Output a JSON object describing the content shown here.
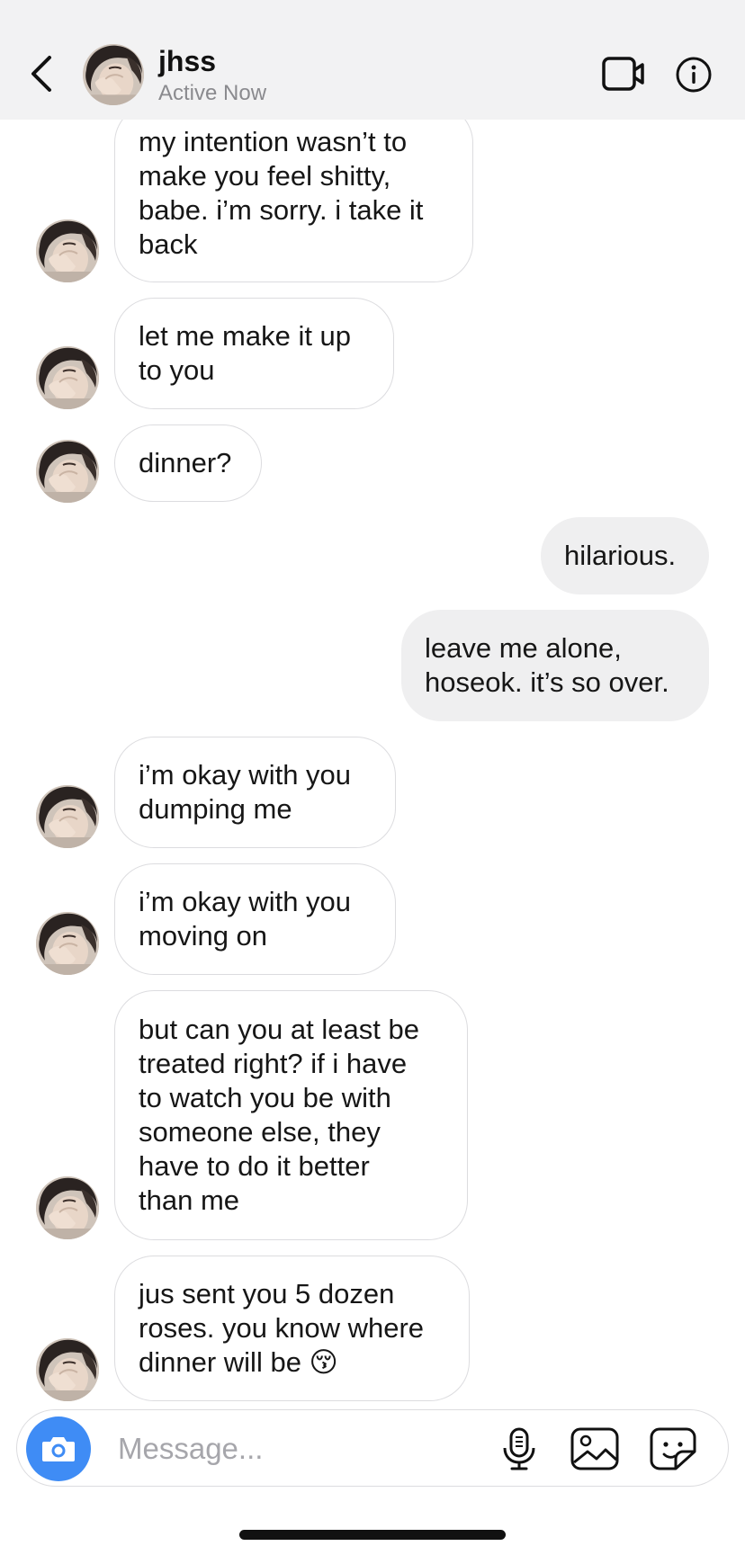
{
  "header": {
    "back_icon": "chevron-left-icon",
    "contact_name": "jhss",
    "status": "Active Now",
    "video_call_icon": "video-camera-icon",
    "info_icon": "info-icon"
  },
  "messages": [
    {
      "sender": "them",
      "text": "my intention wasn’t to\nmake you feel shitty,\nbabe. i’m sorry. i take it\nback"
    },
    {
      "sender": "them",
      "text": "let me make it up\nto you"
    },
    {
      "sender": "them",
      "text": "dinner?"
    },
    {
      "sender": "me",
      "text": "hilarious."
    },
    {
      "sender": "me",
      "text": "leave me alone,\nhoseok. it’s so over."
    },
    {
      "sender": "them",
      "text": "i’m okay with you\ndumping me"
    },
    {
      "sender": "them",
      "text": "i’m okay with you\nmoving on"
    },
    {
      "sender": "them",
      "text": "but can you at least be\ntreated right? if i have\nto watch you be with\nsomeone else, they\nhave to do it better\nthan me"
    },
    {
      "sender": "them",
      "text": "jus sent you 5 dozen\nroses. you know where\ndinner will be 😚"
    }
  ],
  "composer": {
    "placeholder": "Message...",
    "value": "",
    "camera_icon": "camera-icon",
    "mic_icon": "microphone-icon",
    "gallery_icon": "image-icon",
    "sticker_icon": "sticker-icon"
  },
  "colors": {
    "header_bg": "#f2f2f3",
    "outgoing_bubble": "#efeff0",
    "incoming_border": "#dcdcdf",
    "camera_button": "#3f8cf5",
    "status_text": "#8a8a8e"
  }
}
